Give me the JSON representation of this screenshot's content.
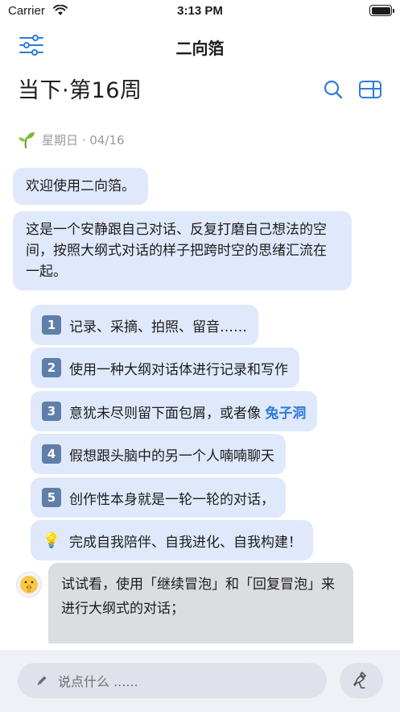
{
  "status_bar": {
    "carrier": "Carrier",
    "time": "3:13 PM"
  },
  "nav": {
    "title": "二向箔"
  },
  "header": {
    "title": "当下·第16周"
  },
  "date_line": {
    "text": "星期日 · 04/16"
  },
  "messages": {
    "welcome": "欢迎使用二向箔。",
    "intro": "这是一个安静跟自己对话、反复打磨自己想法的空间，按照大纲式对话的样子把跨时空的思绪汇流在一起。"
  },
  "items": [
    {
      "marker": "1",
      "text": "记录、采摘、拍照、留音……"
    },
    {
      "marker": "2",
      "text": "使用一种大纲对话体进行记录和写作"
    },
    {
      "marker": "3",
      "text": "意犹未尽则留下面包屑，或者像",
      "link": "兔子洞"
    },
    {
      "marker": "4",
      "text": "假想跟头脑中的另一个人喃喃聊天"
    },
    {
      "marker": "5",
      "text": "创作性本身就是一轮一轮的对话，"
    },
    {
      "marker": "💡",
      "text": "完成自我陪伴、自我进化、自我构建！"
    }
  ],
  "try_bubble": {
    "text": "试试看，使用「继续冒泡」和「回复冒泡」来进行大纲式的对话；"
  },
  "composer": {
    "placeholder": "说点什么 ......"
  },
  "colors": {
    "accent": "#2f7bd8",
    "bubble": "#e0e9fb",
    "bubble_gray": "#dcdde0",
    "number_badge": "#5f7fa8"
  },
  "icons": {
    "filter": "sliders-icon",
    "search": "search-icon",
    "layout": "panel-layout-icon",
    "sprout": "sprout-icon",
    "avatar": "shushing-face-icon",
    "edit": "pencil-icon",
    "send": "broom-icon"
  }
}
